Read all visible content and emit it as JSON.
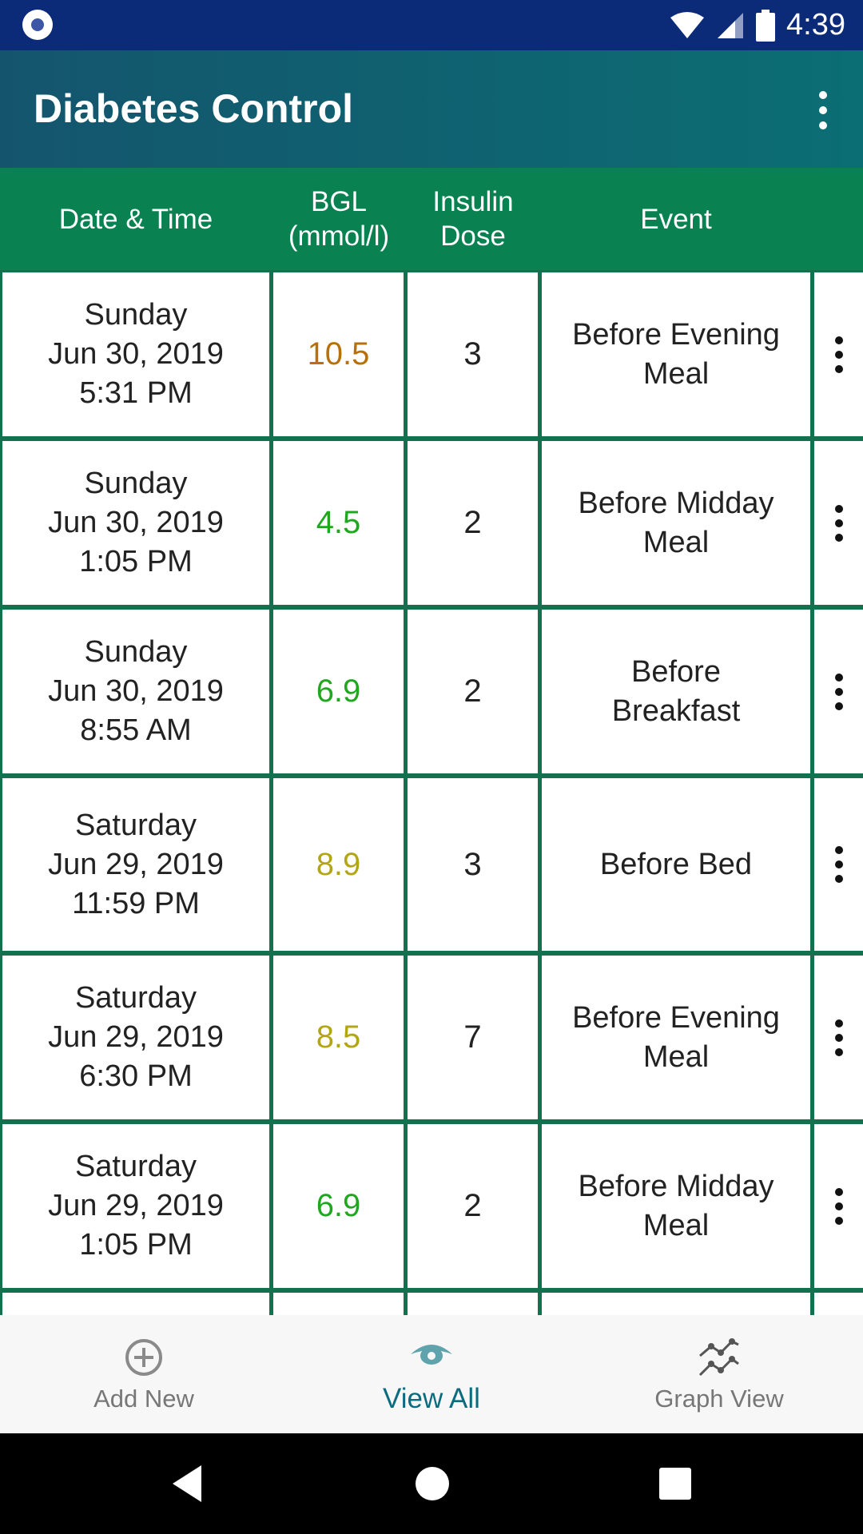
{
  "status_bar": {
    "time": "4:39",
    "icons": [
      "notification-icon",
      "wifi-icon",
      "cell-signal-icon",
      "battery-icon"
    ]
  },
  "app_bar": {
    "title": "Diabetes Control",
    "menu_icon": "more-vert-icon"
  },
  "table": {
    "headers": {
      "date": "Date & Time",
      "bgl_1": "BGL",
      "bgl_2": "(mmol/l)",
      "insulin_1": "Insulin",
      "insulin_2": "Dose",
      "event": "Event"
    },
    "rows": [
      {
        "day": "Sunday",
        "date": "Jun 30, 2019",
        "time": "5:31 PM",
        "bgl": "10.5",
        "bgl_color": "#b8700a",
        "dose": "3",
        "event_1": "Before Evening",
        "event_2": "Meal"
      },
      {
        "day": "Sunday",
        "date": "Jun 30, 2019",
        "time": "1:05 PM",
        "bgl": "4.5",
        "bgl_color": "#1fa81f",
        "dose": "2",
        "event_1": "Before Midday",
        "event_2": "Meal"
      },
      {
        "day": "Sunday",
        "date": "Jun 30, 2019",
        "time": "8:55 AM",
        "bgl": "6.9",
        "bgl_color": "#1fa81f",
        "dose": "2",
        "event_1": "Before",
        "event_2": "Breakfast"
      },
      {
        "day": "Saturday",
        "date": "Jun 29, 2019",
        "time": "11:59 PM",
        "bgl": "8.9",
        "bgl_color": "#b3a614",
        "dose": "3",
        "event_1": "Before Bed",
        "event_2": ""
      },
      {
        "day": "Saturday",
        "date": "Jun 29, 2019",
        "time": "6:30 PM",
        "bgl": "8.5",
        "bgl_color": "#b3a614",
        "dose": "7",
        "event_1": "Before Evening",
        "event_2": "Meal"
      },
      {
        "day": "Saturday",
        "date": "Jun 29, 2019",
        "time": "1:05 PM",
        "bgl": "6.9",
        "bgl_color": "#1fa81f",
        "dose": "2",
        "event_1": "Before Midday",
        "event_2": "Meal"
      }
    ]
  },
  "bottom_nav": {
    "items": [
      {
        "label": "Add New",
        "icon": "add-circle-icon",
        "active": false
      },
      {
        "label": "View All",
        "icon": "eye-icon",
        "active": true
      },
      {
        "label": "Graph View",
        "icon": "graph-icon",
        "active": false
      }
    ]
  },
  "colors": {
    "app_bar": "#14556d",
    "table_header": "#0a8150",
    "grid_line": "#137150",
    "active_nav": "#0d6b80"
  }
}
